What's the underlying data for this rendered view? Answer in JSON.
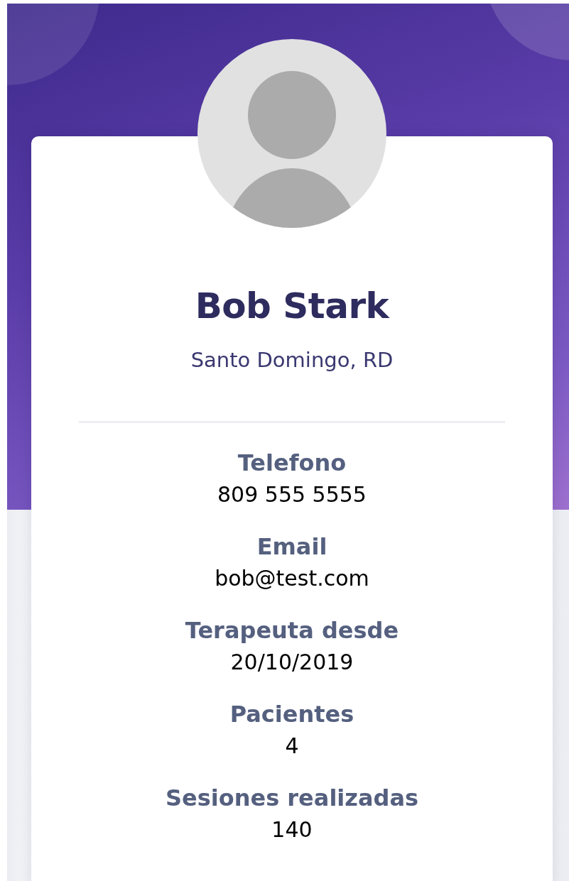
{
  "profile": {
    "name": "Bob Stark",
    "location": "Santo Domingo, RD"
  },
  "fields": [
    {
      "label": "Telefono",
      "value": "809 555 5555"
    },
    {
      "label": "Email",
      "value": "bob@test.com"
    },
    {
      "label": "Terapeuta desde",
      "value": "20/10/2019"
    },
    {
      "label": "Pacientes",
      "value": "4"
    },
    {
      "label": "Sesiones realizadas",
      "value": "140"
    }
  ]
}
